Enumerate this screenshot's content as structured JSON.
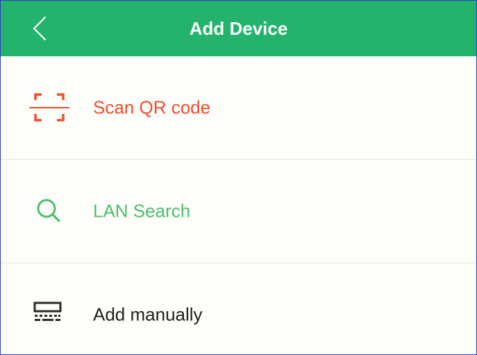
{
  "header": {
    "title": "Add Device"
  },
  "items": [
    {
      "label": "Scan QR code",
      "icon": "scan-qr-icon",
      "color": "#F04E2F"
    },
    {
      "label": "LAN Search",
      "icon": "search-icon",
      "color": "#4CBE6C"
    },
    {
      "label": "Add manually",
      "icon": "keyboard-icon",
      "color": "#1F1F1F"
    }
  ],
  "colors": {
    "header_bg": "#23B36C",
    "page_bg": "#FDFDF9",
    "divider": "#E6E6E0"
  }
}
